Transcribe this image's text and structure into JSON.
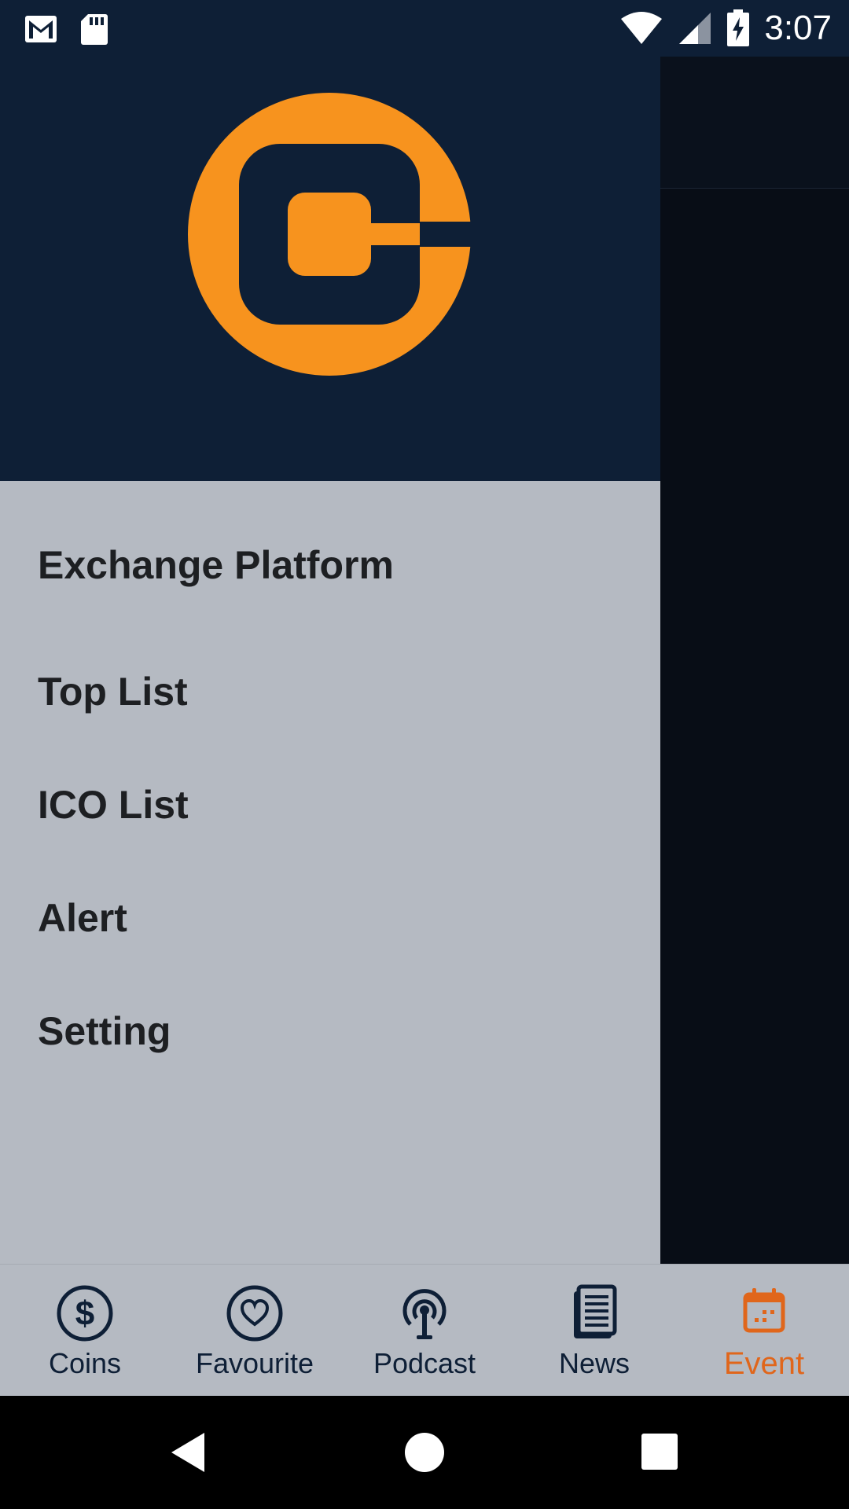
{
  "status_bar": {
    "time": "3:07",
    "icons": [
      "gmail-icon",
      "sd-card-icon",
      "wifi-icon",
      "signal-icon",
      "battery-charging-icon"
    ]
  },
  "drawer": {
    "logo": {
      "icon": "app-logo",
      "accent": "#f7931e",
      "background": "#0e1f36"
    },
    "menu": [
      {
        "label": "Exchange Platform"
      },
      {
        "label": "Top List"
      },
      {
        "label": "ICO List"
      },
      {
        "label": "Alert"
      },
      {
        "label": "Setting"
      }
    ]
  },
  "bottom_nav": {
    "items": [
      {
        "label": "Coins",
        "icon": "dollar-icon",
        "active": false
      },
      {
        "label": "Favourite",
        "icon": "heart-icon",
        "active": false
      },
      {
        "label": "Podcast",
        "icon": "podcast-icon",
        "active": false
      },
      {
        "label": "News",
        "icon": "news-icon",
        "active": false
      },
      {
        "label": "Event",
        "icon": "calendar-icon",
        "active": true
      }
    ],
    "active_color": "#e0661b",
    "inactive_color": "#0e1f36"
  },
  "system_nav": {
    "buttons": [
      "back-icon",
      "home-icon",
      "recents-icon"
    ]
  }
}
